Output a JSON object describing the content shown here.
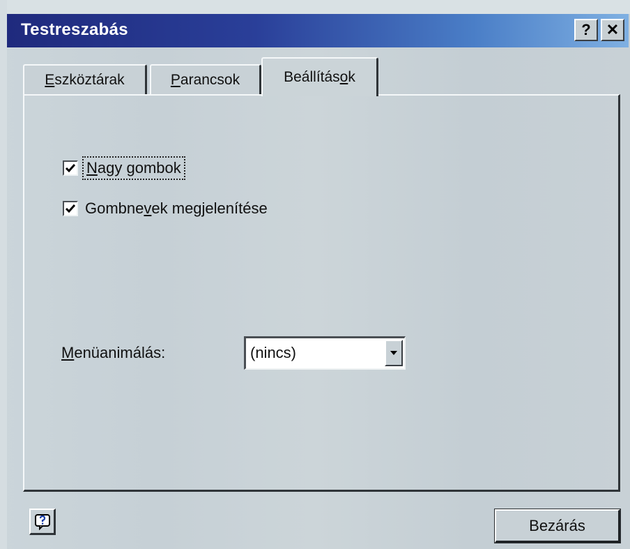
{
  "window": {
    "title": "Testreszabás",
    "help_button": "?",
    "close_button": "✕"
  },
  "tabs": [
    {
      "label_pre": "",
      "label_ul": "E",
      "label_post": "szköztárak",
      "selected": false
    },
    {
      "label_pre": "",
      "label_ul": "P",
      "label_post": "arancsok",
      "selected": false
    },
    {
      "label_pre": "Beállítás",
      "label_ul": "o",
      "label_post": "k",
      "selected": true
    }
  ],
  "options": {
    "large_buttons": {
      "label_pre": "",
      "label_ul": "N",
      "label_post": "agy gombok",
      "checked": true
    },
    "show_names": {
      "label_pre": "Gombne",
      "label_ul": "v",
      "label_post": "ek megjelenítése",
      "checked": true
    }
  },
  "menu_animation": {
    "label_pre": "",
    "label_ul": "M",
    "label_post": "enüanimálás:",
    "value": "(nincs)"
  },
  "footer": {
    "close_label": "Bezárás"
  },
  "colors": {
    "title_gradient_start": "#1f2a7d",
    "title_gradient_end": "#7fb0e2",
    "face": "#c8d1d6"
  }
}
